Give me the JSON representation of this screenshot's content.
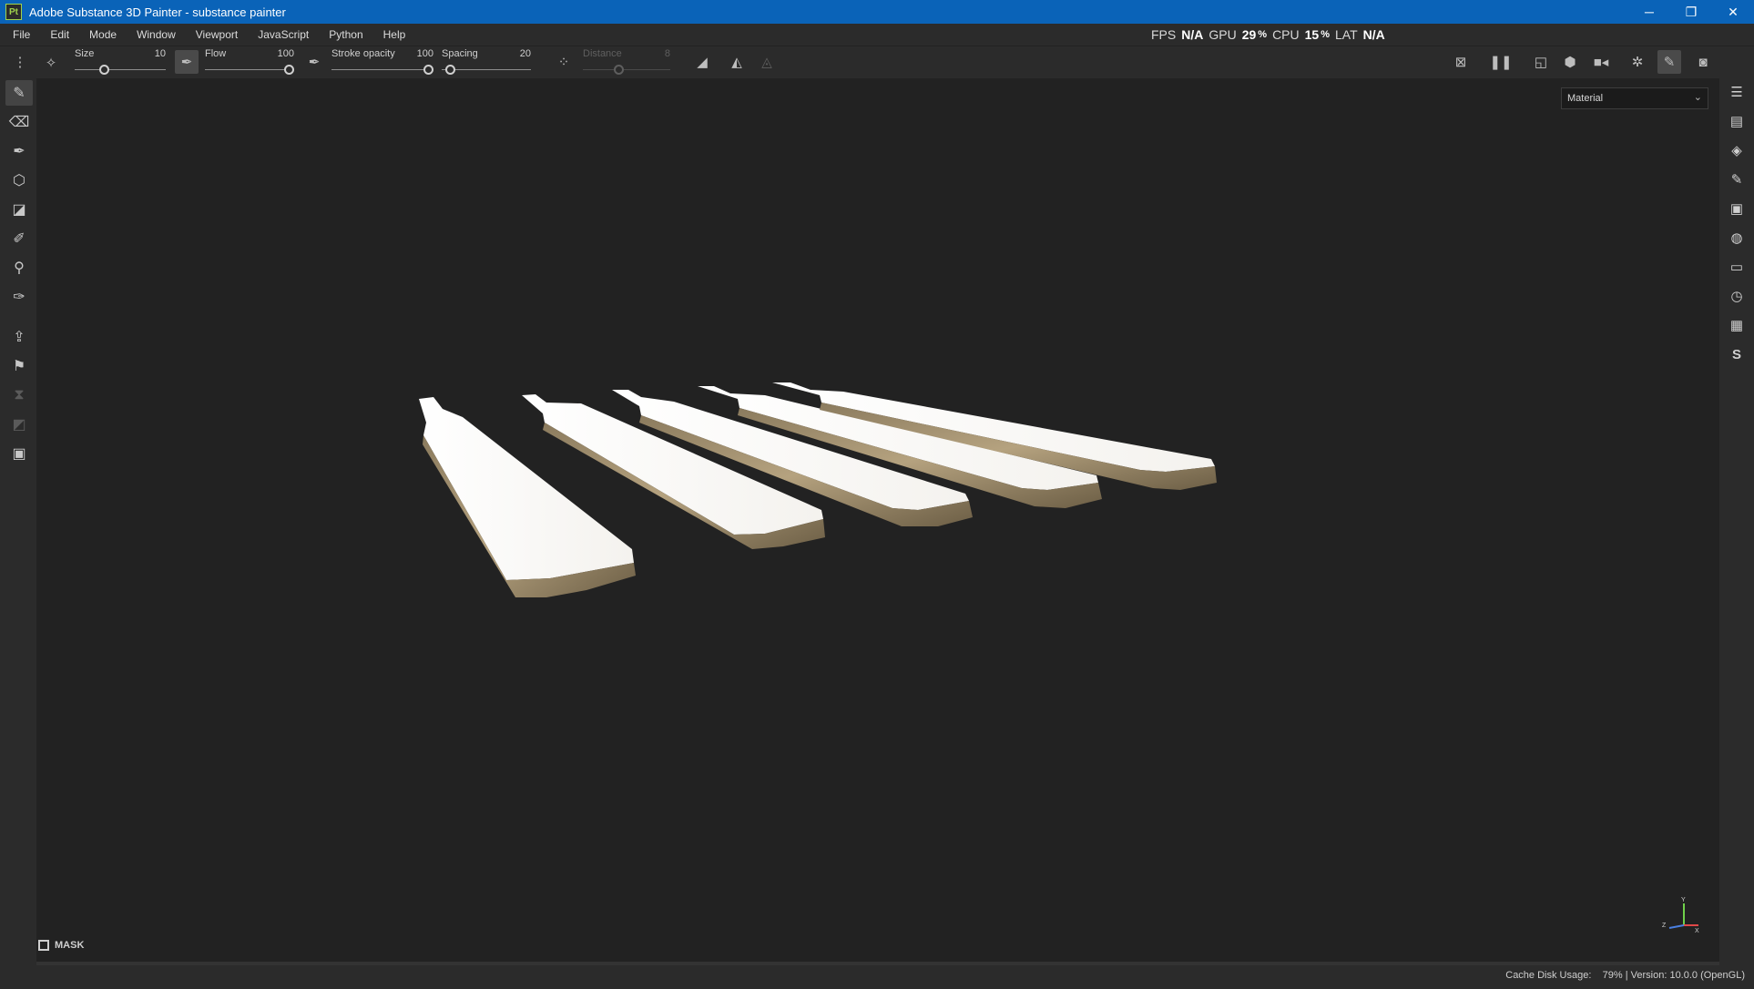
{
  "window": {
    "logo_text": "Pt",
    "title": "Adobe Substance 3D Painter - substance painter",
    "minimize": "─",
    "restore": "❐",
    "close": "✕"
  },
  "menu": [
    "File",
    "Edit",
    "Mode",
    "Window",
    "Viewport",
    "JavaScript",
    "Python",
    "Help"
  ],
  "performance": {
    "fps_label": "FPS",
    "fps_value": "N/A",
    "gpu_label": "GPU",
    "gpu_value": "29",
    "gpu_unit": "%",
    "cpu_label": "CPU",
    "cpu_value": "15",
    "cpu_unit": "%",
    "lat_label": "LAT",
    "lat_value": "N/A"
  },
  "tool_properties": {
    "size": {
      "label": "Size",
      "value": "10",
      "level": 0.3
    },
    "flow": {
      "label": "Flow",
      "value": "100",
      "level": 1.0
    },
    "stroke_opacity": {
      "label": "Stroke opacity",
      "value": "100",
      "level": 1.0
    },
    "spacing": {
      "label": "Spacing",
      "value": "20",
      "level": 0.05
    },
    "distance": {
      "label": "Distance",
      "value": "8",
      "level": 0.4,
      "enabled": false
    }
  },
  "viewport": {
    "channel_select": "Material",
    "mask_label": "MASK",
    "axis_labels": {
      "y": "Y",
      "x": "X",
      "z": "Z"
    }
  },
  "left_tools": [
    {
      "name": "paint-brush-icon",
      "glyph": "✎",
      "active": true
    },
    {
      "name": "eraser-icon",
      "glyph": "⌫"
    },
    {
      "name": "projection-icon",
      "glyph": "✒"
    },
    {
      "name": "geometry-mask-icon",
      "glyph": "⬡"
    },
    {
      "name": "polygon-fill-icon",
      "glyph": "◪"
    },
    {
      "name": "smudge-icon",
      "glyph": "✐"
    },
    {
      "name": "clone-stamp-icon",
      "glyph": "⚲"
    },
    {
      "name": "color-picker-icon",
      "glyph": "✑"
    },
    {
      "name": "bake-icon",
      "glyph": "⇪"
    },
    {
      "name": "measure-icon",
      "glyph": "⚑"
    },
    {
      "name": "hourglass-icon",
      "glyph": "⧗",
      "dim": true
    },
    {
      "name": "uv-icon",
      "glyph": "◩",
      "dim": true
    },
    {
      "name": "render-icon",
      "glyph": "▣"
    }
  ],
  "right_panels": [
    {
      "name": "layers-list-icon",
      "glyph": "☰"
    },
    {
      "name": "texture-set-icon",
      "glyph": "▤"
    },
    {
      "name": "layer-stack-icon",
      "glyph": "◈"
    },
    {
      "name": "properties-icon",
      "glyph": "✎"
    },
    {
      "name": "display-settings-icon",
      "glyph": "▣"
    },
    {
      "name": "shader-settings-icon",
      "glyph": "◍"
    },
    {
      "name": "assets-icon",
      "glyph": "▭"
    },
    {
      "name": "history-icon",
      "glyph": "◷"
    },
    {
      "name": "log-icon",
      "glyph": "▦"
    },
    {
      "name": "substance-share-icon",
      "glyph": "S"
    }
  ],
  "status": {
    "cache_label": "Cache Disk Usage:",
    "cache_value": "79%",
    "version": "| Version: 10.0.0 (OpenGL)"
  }
}
